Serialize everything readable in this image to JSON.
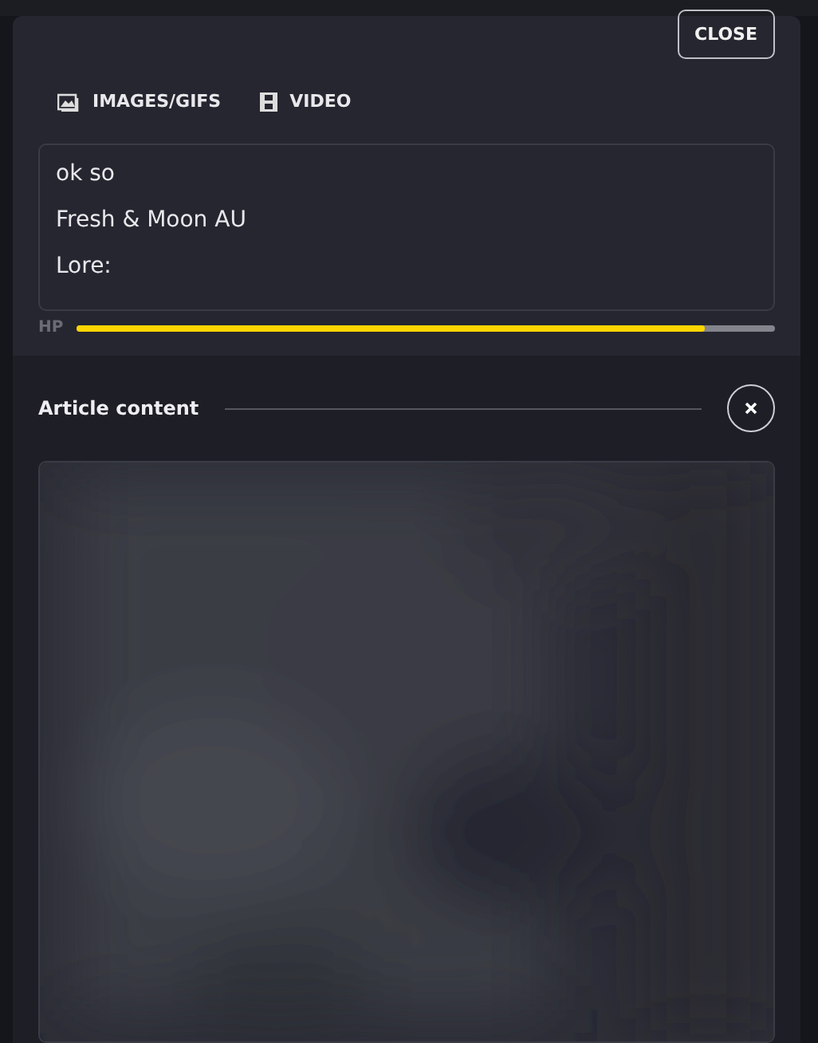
{
  "modal": {
    "close_button": "CLOSE",
    "media_tabs": [
      {
        "label": "IMAGES/GIFS",
        "kind": "images"
      },
      {
        "label": "VIDEO",
        "kind": "video"
      }
    ],
    "editor_lines": [
      "ok so",
      "Fresh & Moon AU",
      "Lore:"
    ],
    "hp": {
      "label": "HP",
      "level": 0.9
    },
    "article": {
      "title": "Article content"
    }
  }
}
